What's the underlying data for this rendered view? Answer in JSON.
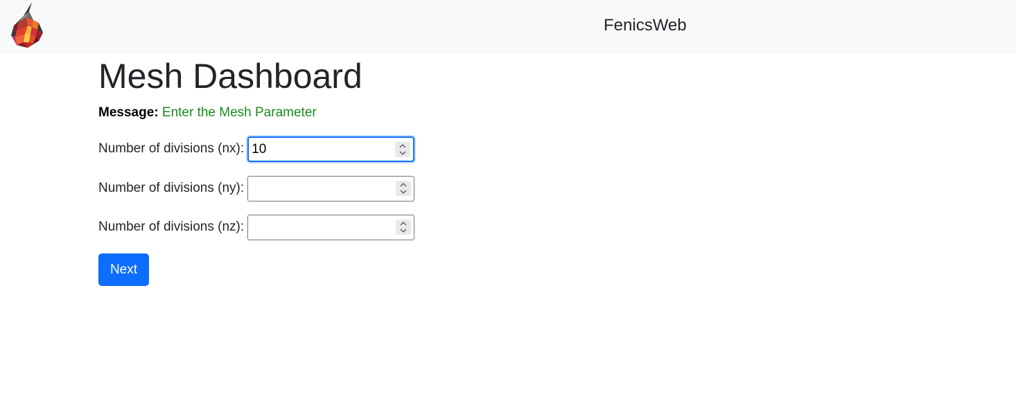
{
  "navbar": {
    "logo_icon": "fenics-flame-logo-icon",
    "brand": "FenicsWeb"
  },
  "main": {
    "title": "Mesh Dashboard",
    "message": {
      "label": "Message:",
      "text": "Enter the Mesh Parameter",
      "text_color": "#198a1d"
    },
    "fields": [
      {
        "label": "Number of divisions (nx):",
        "value": "10",
        "placeholder": ""
      },
      {
        "label": "Number of divisions (ny):",
        "value": "",
        "placeholder": ""
      },
      {
        "label": "Number of divisions (nz):",
        "value": "",
        "placeholder": ""
      }
    ],
    "next_button": {
      "label": "Next",
      "color": "#0d6efd"
    }
  }
}
